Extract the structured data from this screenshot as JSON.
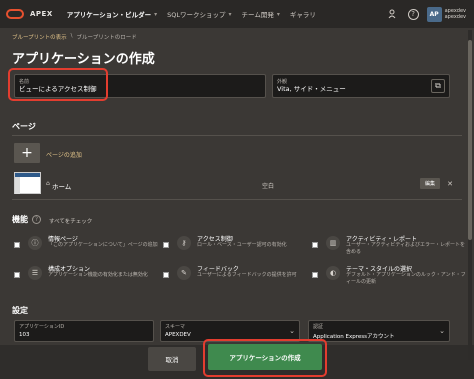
{
  "topbar": {
    "brand": "APEX",
    "nav": [
      {
        "label": "アプリケーション・ビルダー",
        "active": true
      },
      {
        "label": "SQLワークショップ",
        "active": false
      },
      {
        "label": "チーム開発",
        "active": false
      },
      {
        "label": "ギャラリ",
        "active": false
      }
    ],
    "avatar_initials": "AP",
    "user_name": "apexdev",
    "user_workspace": "apexdev"
  },
  "breadcrumb": {
    "items": [
      "ブループリントの表示",
      "ブループリントのロード"
    ]
  },
  "page_title": "アプリケーションの作成",
  "name_field": {
    "label": "名前",
    "value": "ビューによるアクセス制御"
  },
  "appearance_field": {
    "label": "外観",
    "value": "Vita, サイド・メニュー"
  },
  "pages_section": {
    "title": "ページ",
    "add_label": "ページの追加",
    "pages": [
      {
        "name": "ホーム",
        "type": "空白",
        "edit_label": "編集"
      }
    ]
  },
  "features_section": {
    "title": "機能",
    "check_all": "すべてをチェック",
    "features": [
      {
        "title": "情報ページ",
        "desc": "「このアプリケーションについて」ページの追加",
        "icon": "info-icon"
      },
      {
        "title": "アクセス制御",
        "desc": "ロール・ベース・ユーザー認可の有効化",
        "icon": "key-icon"
      },
      {
        "title": "アクティビティ・レポート",
        "desc": "ユーザー・アクティビティおよびエラー・レポートを含める",
        "icon": "chart-icon"
      },
      {
        "title": "構成オプション",
        "desc": "アプリケーション機能の有効化または無効化",
        "icon": "sliders-icon"
      },
      {
        "title": "フィードバック",
        "desc": "ユーザーによるフィードバックの提供を許可",
        "icon": "feedback-icon"
      },
      {
        "title": "テーマ・スタイルの選択",
        "desc": "デフォルト・アプリケーションのルック・アンド・フィールの更新",
        "icon": "palette-icon"
      }
    ]
  },
  "settings_section": {
    "title": "設定",
    "fields": [
      {
        "label": "アプリケーションID",
        "value": "103"
      },
      {
        "label": "スキーマ",
        "value": "APEXDEV"
      },
      {
        "label": "認証",
        "value": "Application Expressアカウント"
      }
    ]
  },
  "footer": {
    "cancel_label": "取消",
    "create_label": "アプリケーションの作成"
  }
}
